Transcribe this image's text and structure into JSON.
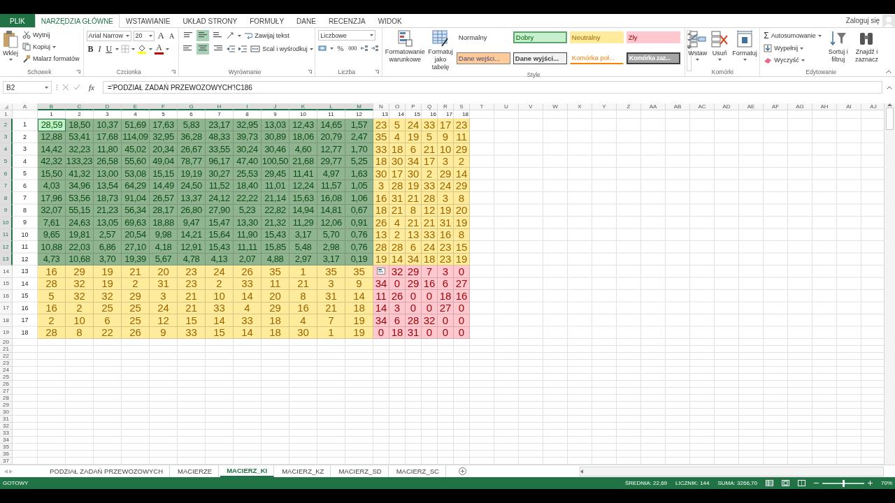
{
  "ribbon_tabs": [
    {
      "label": "PLIK",
      "kind": "file",
      "selected": false
    },
    {
      "label": "NARZĘDZIA GŁÓWNE",
      "kind": "tab",
      "selected": true
    },
    {
      "label": "WSTAWIANIE",
      "kind": "tab",
      "selected": false
    },
    {
      "label": "UKŁAD STRONY",
      "kind": "tab",
      "selected": false
    },
    {
      "label": "FORMUŁY",
      "kind": "tab",
      "selected": false
    },
    {
      "label": "DANE",
      "kind": "tab",
      "selected": false
    },
    {
      "label": "RECENZJA",
      "kind": "tab",
      "selected": false
    },
    {
      "label": "WIDOK",
      "kind": "tab",
      "selected": false
    }
  ],
  "account": {
    "label": "Zaloguj się"
  },
  "clipboard": {
    "title": "Schowek",
    "paste": "Wklej",
    "actions": [
      "Wytnij",
      "Kopiuj",
      "Malarz formatów"
    ]
  },
  "font": {
    "title": "Czcionka",
    "font_name": "Arial Narrow",
    "font_size": "20",
    "grow": "A",
    "shrink": "A",
    "bold": "B",
    "italic": "I",
    "underline": "U",
    "font_color": "A"
  },
  "alignment": {
    "title": "Wyrównanie",
    "vertical": [
      {
        "selected": false
      },
      {
        "selected": true
      },
      {
        "selected": false
      }
    ],
    "horizontal": [
      {
        "selected": false
      },
      {
        "selected": true
      },
      {
        "selected": false
      }
    ],
    "wrap": "Zawijaj tekst",
    "merge": "Scal i wyśrodkuj"
  },
  "number": {
    "title": "Liczba",
    "format": "Liczbowe",
    "percent": "%",
    "thousands": "000"
  },
  "styles": {
    "title": "Style",
    "conditional": "Formatowanie warunkowe",
    "as_table": "Formatuj jako tabelę",
    "gallery": [
      {
        "label": "Normalny",
        "kind": "normal",
        "selected": false
      },
      {
        "label": "Dobry",
        "kind": "good",
        "selected": true
      },
      {
        "label": "Neutralny",
        "kind": "neutral",
        "selected": false
      },
      {
        "label": "Zły",
        "kind": "bad",
        "selected": false
      },
      {
        "label": "Dane wejści...",
        "kind": "input",
        "selected": false
      },
      {
        "label": "Dane wyjści...",
        "kind": "output",
        "selected": false
      },
      {
        "label": "Komórka poł...",
        "kind": "linked",
        "selected": false
      },
      {
        "label": "Komórka zaz...",
        "kind": "check",
        "selected": false
      }
    ]
  },
  "cells": {
    "title": "Komórki",
    "actions": [
      "Wstaw",
      "Usuń",
      "Formatuj"
    ]
  },
  "editing": {
    "title": "Edytowanie",
    "sum_symbol": "Σ",
    "small": [
      "Autosumowanie",
      "Wypełnij",
      "Wyczyść"
    ],
    "large": [
      "Sortuj i filtruj",
      "Znajdź i zaznacz"
    ]
  },
  "formula_bar": {
    "name_box": "B2",
    "fx": "fx",
    "formula": "='PODZIAŁ ZADAŃ PRZEWOZOWYCH'!C186"
  },
  "sheet": {
    "columns": [
      {
        "label": "A",
        "selected": false
      },
      {
        "label": "B",
        "selected": true
      },
      {
        "label": "C",
        "selected": true
      },
      {
        "label": "D",
        "selected": true
      },
      {
        "label": "E",
        "selected": true
      },
      {
        "label": "F",
        "selected": true
      },
      {
        "label": "G",
        "selected": true
      },
      {
        "label": "H",
        "selected": true
      },
      {
        "label": "I",
        "selected": true
      },
      {
        "label": "J",
        "selected": true
      },
      {
        "label": "K",
        "selected": true
      },
      {
        "label": "L",
        "selected": true
      },
      {
        "label": "M",
        "selected": true
      },
      {
        "label": "N",
        "selected": false
      },
      {
        "label": "O",
        "selected": false
      },
      {
        "label": "P",
        "selected": false
      },
      {
        "label": "Q",
        "selected": false
      },
      {
        "label": "R",
        "selected": false
      },
      {
        "label": "S",
        "selected": false
      },
      {
        "label": "T",
        "selected": false
      },
      {
        "label": "U",
        "selected": false
      },
      {
        "label": "V",
        "selected": false
      },
      {
        "label": "W",
        "selected": false
      },
      {
        "label": "X",
        "selected": false
      },
      {
        "label": "Y",
        "selected": false
      },
      {
        "label": "Z",
        "selected": false
      },
      {
        "label": "AA",
        "selected": false
      },
      {
        "label": "AB",
        "selected": false
      },
      {
        "label": "AC",
        "selected": false
      },
      {
        "label": "AD",
        "selected": false
      },
      {
        "label": "AE",
        "selected": false
      },
      {
        "label": "AF",
        "selected": false
      },
      {
        "label": "AG",
        "selected": false
      },
      {
        "label": "AH",
        "selected": false
      },
      {
        "label": "AI",
        "selected": false
      },
      {
        "label": "AJ",
        "selected": false
      }
    ],
    "index_row": {
      "header": "1",
      "selected": false,
      "cells": [
        "1",
        "2",
        "3",
        "4",
        "5",
        "6",
        "7",
        "8",
        "9",
        "10",
        "11",
        "12",
        "13",
        "14",
        "15",
        "16",
        "17",
        "18"
      ]
    },
    "rows": [
      {
        "header": "2",
        "selected": true,
        "label": "1",
        "left": {
          "kind": "good",
          "cells": [
            {
              "value": "28,59",
              "active": true
            },
            "18,50",
            "10,37",
            "51,69",
            "17,63",
            "5,83",
            "23,17",
            "32,95",
            "13,03",
            "12,43",
            "14,65",
            "1,57"
          ]
        },
        "right": {
          "kind": "neutral",
          "cells": [
            "23",
            "5",
            "24",
            "33",
            "17",
            "23"
          ]
        }
      },
      {
        "header": "3",
        "selected": true,
        "label": "2",
        "left": {
          "kind": "good",
          "cells": [
            "12,88",
            "53,41",
            "17,68",
            "114,09",
            "32,95",
            "36,28",
            "48,33",
            "39,73",
            "30,89",
            "18,06",
            "20,79",
            "2,47"
          ]
        },
        "right": {
          "kind": "neutral",
          "cells": [
            "35",
            "4",
            "19",
            "5",
            "9",
            "11"
          ]
        }
      },
      {
        "header": "4",
        "selected": true,
        "label": "3",
        "left": {
          "kind": "good",
          "cells": [
            "14,42",
            "32,23",
            "11,80",
            "45,02",
            "20,34",
            "26,67",
            "33,55",
            "30,24",
            "30,46",
            "4,60",
            "12,77",
            "1,70"
          ]
        },
        "right": {
          "kind": "neutral",
          "cells": [
            "33",
            "18",
            "6",
            "21",
            "10",
            "29"
          ]
        }
      },
      {
        "header": "5",
        "selected": true,
        "label": "4",
        "left": {
          "kind": "good",
          "cells": [
            "42,32",
            "133,23",
            "26,58",
            "55,60",
            "49,04",
            "78,77",
            "96,17",
            "47,40",
            "100,50",
            "21,68",
            "29,77",
            "5,25"
          ]
        },
        "right": {
          "kind": "neutral",
          "cells": [
            "18",
            "30",
            "34",
            "17",
            "3",
            "2"
          ]
        }
      },
      {
        "header": "6",
        "selected": true,
        "label": "5",
        "left": {
          "kind": "good",
          "cells": [
            "15,50",
            "41,32",
            "13,00",
            "53,08",
            "15,15",
            "19,19",
            "30,27",
            "25,53",
            "29,45",
            "11,41",
            "4,97",
            "1,63"
          ]
        },
        "right": {
          "kind": "neutral",
          "cells": [
            "30",
            "17",
            "30",
            "2",
            "29",
            "14"
          ]
        }
      },
      {
        "header": "7",
        "selected": true,
        "label": "6",
        "left": {
          "kind": "good",
          "cells": [
            "4,03",
            "34,96",
            "13,54",
            "64,29",
            "14,49",
            "24,50",
            "11,52",
            "18,40",
            "11,01",
            "12,24",
            "11,57",
            "1,05"
          ]
        },
        "right": {
          "kind": "neutral",
          "cells": [
            "3",
            "28",
            "19",
            "33",
            "24",
            "29"
          ]
        }
      },
      {
        "header": "8",
        "selected": true,
        "label": "7",
        "left": {
          "kind": "good",
          "cells": [
            "17,96",
            "53,56",
            "18,73",
            "91,04",
            "26,57",
            "13,37",
            "24,12",
            "22,22",
            "21,14",
            "15,63",
            "16,08",
            "1,06"
          ]
        },
        "right": {
          "kind": "neutral",
          "cells": [
            "16",
            "31",
            "21",
            "28",
            "3",
            "8"
          ]
        }
      },
      {
        "header": "9",
        "selected": true,
        "label": "8",
        "left": {
          "kind": "good",
          "cells": [
            "32,07",
            "55,15",
            "21,23",
            "56,34",
            "28,17",
            "26,80",
            "27,90",
            "5,23",
            "22,82",
            "14,94",
            "14,81",
            "0,67"
          ]
        },
        "right": {
          "kind": "neutral",
          "cells": [
            "18",
            "21",
            "8",
            "12",
            "19",
            "20"
          ]
        }
      },
      {
        "header": "10",
        "selected": true,
        "label": "9",
        "left": {
          "kind": "good",
          "cells": [
            "7,61",
            "24,63",
            "13,05",
            "69,63",
            "18,88",
            "9,47",
            "15,47",
            "13,30",
            "21,32",
            "11,29",
            "12,06",
            "0,91"
          ]
        },
        "right": {
          "kind": "neutral",
          "cells": [
            "26",
            "4",
            "21",
            "21",
            "31",
            "19"
          ]
        }
      },
      {
        "header": "11",
        "selected": true,
        "label": "10",
        "left": {
          "kind": "good",
          "cells": [
            "9,65",
            "19,81",
            "2,57",
            "20,54",
            "9,98",
            "14,21",
            "15,64",
            "11,90",
            "15,43",
            "3,17",
            "5,70",
            "0,76"
          ]
        },
        "right": {
          "kind": "neutral",
          "cells": [
            "13",
            "2",
            "13",
            "33",
            "16",
            "8"
          ]
        }
      },
      {
        "header": "12",
        "selected": true,
        "label": "11",
        "left": {
          "kind": "good",
          "cells": [
            "10,88",
            "22,03",
            "6,86",
            "27,10",
            "4,18",
            "12,91",
            "15,43",
            "11,11",
            "15,85",
            "5,48",
            "2,98",
            "0,76"
          ]
        },
        "right": {
          "kind": "neutral",
          "cells": [
            "28",
            "28",
            "6",
            "24",
            "23",
            "15"
          ]
        }
      },
      {
        "header": "13",
        "selected": true,
        "label": "12",
        "left": {
          "kind": "good",
          "cells": [
            "4,73",
            "10,68",
            "3,70",
            "19,39",
            "5,67",
            "4,78",
            "4,13",
            "2,07",
            "4,88",
            "2,97",
            "3,17",
            "0,19"
          ]
        },
        "right": {
          "kind": "neutral",
          "cells": [
            "19",
            "14",
            "34",
            "18",
            "23",
            "19"
          ]
        }
      },
      {
        "header": "14",
        "selected": false,
        "label": "13",
        "left": {
          "kind": "neutral",
          "cells": [
            "16",
            "29",
            "19",
            "21",
            "20",
            "23",
            "24",
            "26",
            "35",
            "1",
            "35",
            "35"
          ]
        },
        "right": {
          "kind": "bad",
          "cells": [
            {
              "kind": "paste-options"
            },
            "32",
            "29",
            "7",
            "3",
            "0"
          ]
        }
      },
      {
        "header": "15",
        "selected": false,
        "label": "14",
        "left": {
          "kind": "neutral",
          "cells": [
            "28",
            "32",
            "19",
            "2",
            "31",
            "23",
            "2",
            "33",
            "11",
            "21",
            "3",
            "9"
          ]
        },
        "right": {
          "kind": "bad",
          "cells": [
            "34",
            "0",
            "29",
            "16",
            "6",
            "27"
          ]
        }
      },
      {
        "header": "16",
        "selected": false,
        "label": "15",
        "left": {
          "kind": "neutral",
          "cells": [
            "5",
            "32",
            "32",
            "29",
            "3",
            "21",
            "10",
            "14",
            "20",
            "8",
            "31",
            "14"
          ]
        },
        "right": {
          "kind": "bad",
          "cells": [
            "11",
            "26",
            "0",
            "0",
            "18",
            "16"
          ]
        }
      },
      {
        "header": "17",
        "selected": false,
        "label": "16",
        "left": {
          "kind": "neutral",
          "cells": [
            "16",
            "2",
            "25",
            "25",
            "24",
            "21",
            "33",
            "4",
            "29",
            "16",
            "21",
            "18"
          ]
        },
        "right": {
          "kind": "bad",
          "cells": [
            "14",
            "3",
            "0",
            "0",
            "27",
            "0"
          ]
        }
      },
      {
        "header": "18",
        "selected": false,
        "label": "17",
        "left": {
          "kind": "neutral",
          "cells": [
            "2",
            "10",
            "6",
            "25",
            "12",
            "15",
            "14",
            "33",
            "18",
            "4",
            "7",
            "19"
          ]
        },
        "right": {
          "kind": "bad",
          "cells": [
            "34",
            "6",
            "28",
            "32",
            "0",
            "0"
          ]
        }
      },
      {
        "header": "19",
        "selected": false,
        "label": "18",
        "left": {
          "kind": "neutral",
          "cells": [
            "28",
            "8",
            "22",
            "26",
            "9",
            "33",
            "15",
            "14",
            "18",
            "30",
            "1",
            "19"
          ]
        },
        "right": {
          "kind": "bad",
          "cells": [
            "0",
            "18",
            "31",
            "0",
            "0",
            "0"
          ]
        }
      }
    ],
    "empty_rows": [
      {
        "header": "20",
        "selected": false
      },
      {
        "header": "21",
        "selected": false
      },
      {
        "header": "22",
        "selected": false
      },
      {
        "header": "23",
        "selected": false
      },
      {
        "header": "24",
        "selected": false
      },
      {
        "header": "25",
        "selected": false
      },
      {
        "header": "26",
        "selected": false
      },
      {
        "header": "27",
        "selected": false
      },
      {
        "header": "28",
        "selected": false
      },
      {
        "header": "29",
        "selected": false
      },
      {
        "header": "30",
        "selected": false
      },
      {
        "header": "31",
        "selected": false
      },
      {
        "header": "32",
        "selected": false
      },
      {
        "header": "33",
        "selected": false
      },
      {
        "header": "34",
        "selected": false
      },
      {
        "header": "35",
        "selected": false
      },
      {
        "header": "36",
        "selected": false
      },
      {
        "header": "37",
        "selected": false
      }
    ]
  },
  "sheet_tabs": [
    {
      "label": "PODZIAŁ ZADAŃ PRZEWOZOWYCH",
      "selected": false
    },
    {
      "label": "MACIERZE",
      "selected": false
    },
    {
      "label": "MACIERZ_KI",
      "selected": true
    },
    {
      "label": "MACIERZ_KZ",
      "selected": false
    },
    {
      "label": "MACIERZ_SD",
      "selected": false
    },
    {
      "label": "MACIERZ_SC",
      "selected": false
    }
  ],
  "status_bar": {
    "mode": "GOTOWY",
    "average": "ŚREDNIA: 22,69",
    "count": "LICZNIK: 144",
    "sum": "SUMA: 3266,70",
    "zoom_slider": {
      "level": 0.5
    },
    "zoom": "70%"
  }
}
